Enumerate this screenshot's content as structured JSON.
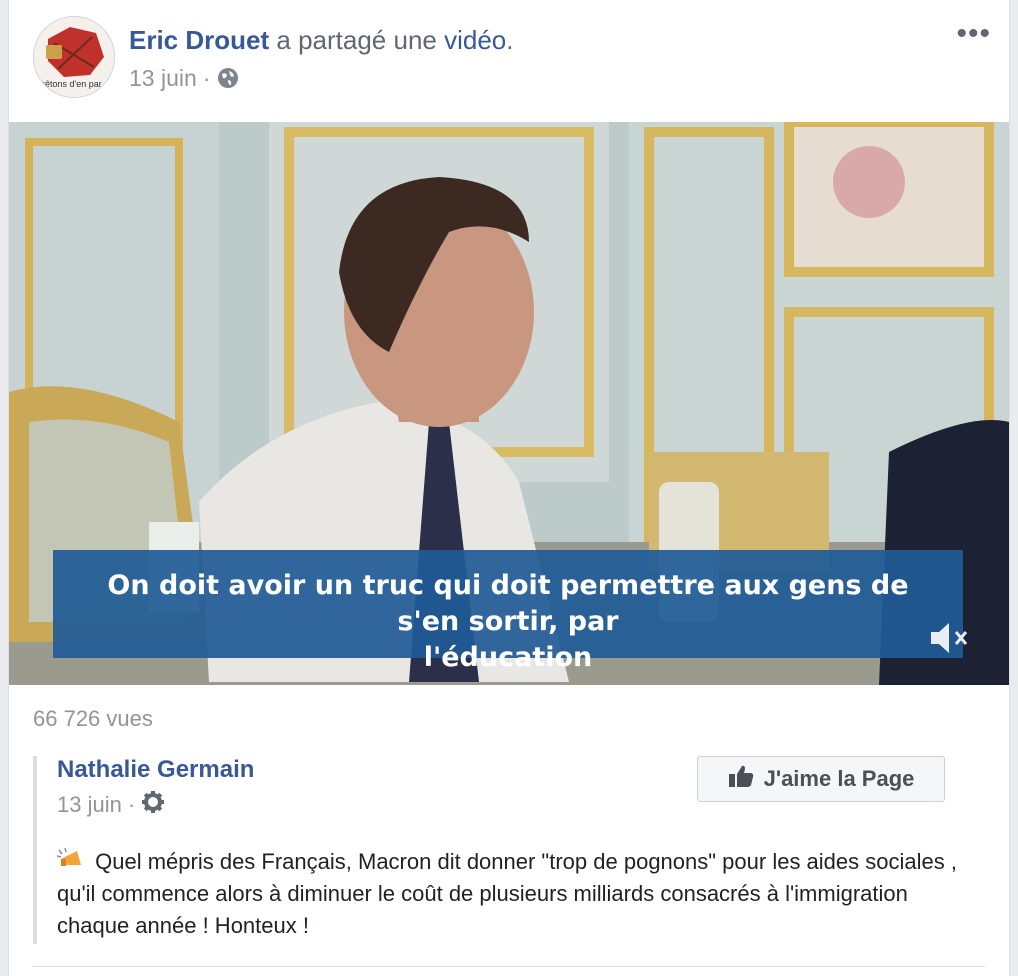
{
  "header": {
    "author": "Eric Drouet",
    "action_text": "a partagé une",
    "object_link": "vidéo",
    "period": ".",
    "date": "13 juin",
    "separator": "·",
    "avatar_caption": "rêtons d'en par",
    "more_label": "•••"
  },
  "video": {
    "subtitle_line1": "On doit avoir un truc qui doit permettre aux gens de s'en sortir, par",
    "subtitle_line2": "l'éducation",
    "muted": true,
    "views": "66 726 vues"
  },
  "shared_post": {
    "page_name": "Nathalie Germain",
    "date": "13 juin",
    "separator": "·",
    "like_button_label": "J'aime la Page",
    "text": "Quel mépris des Français, Macron dit donner \"trop de pognons\" pour les aides sociales , qu'il commence alors à diminuer le coût de plusieurs milliards consacrés à l'immigration chaque année ! Honteux !"
  },
  "colors": {
    "link": "#385898",
    "meta": "#90949c",
    "subtitle_bg": "#1f5b96"
  }
}
